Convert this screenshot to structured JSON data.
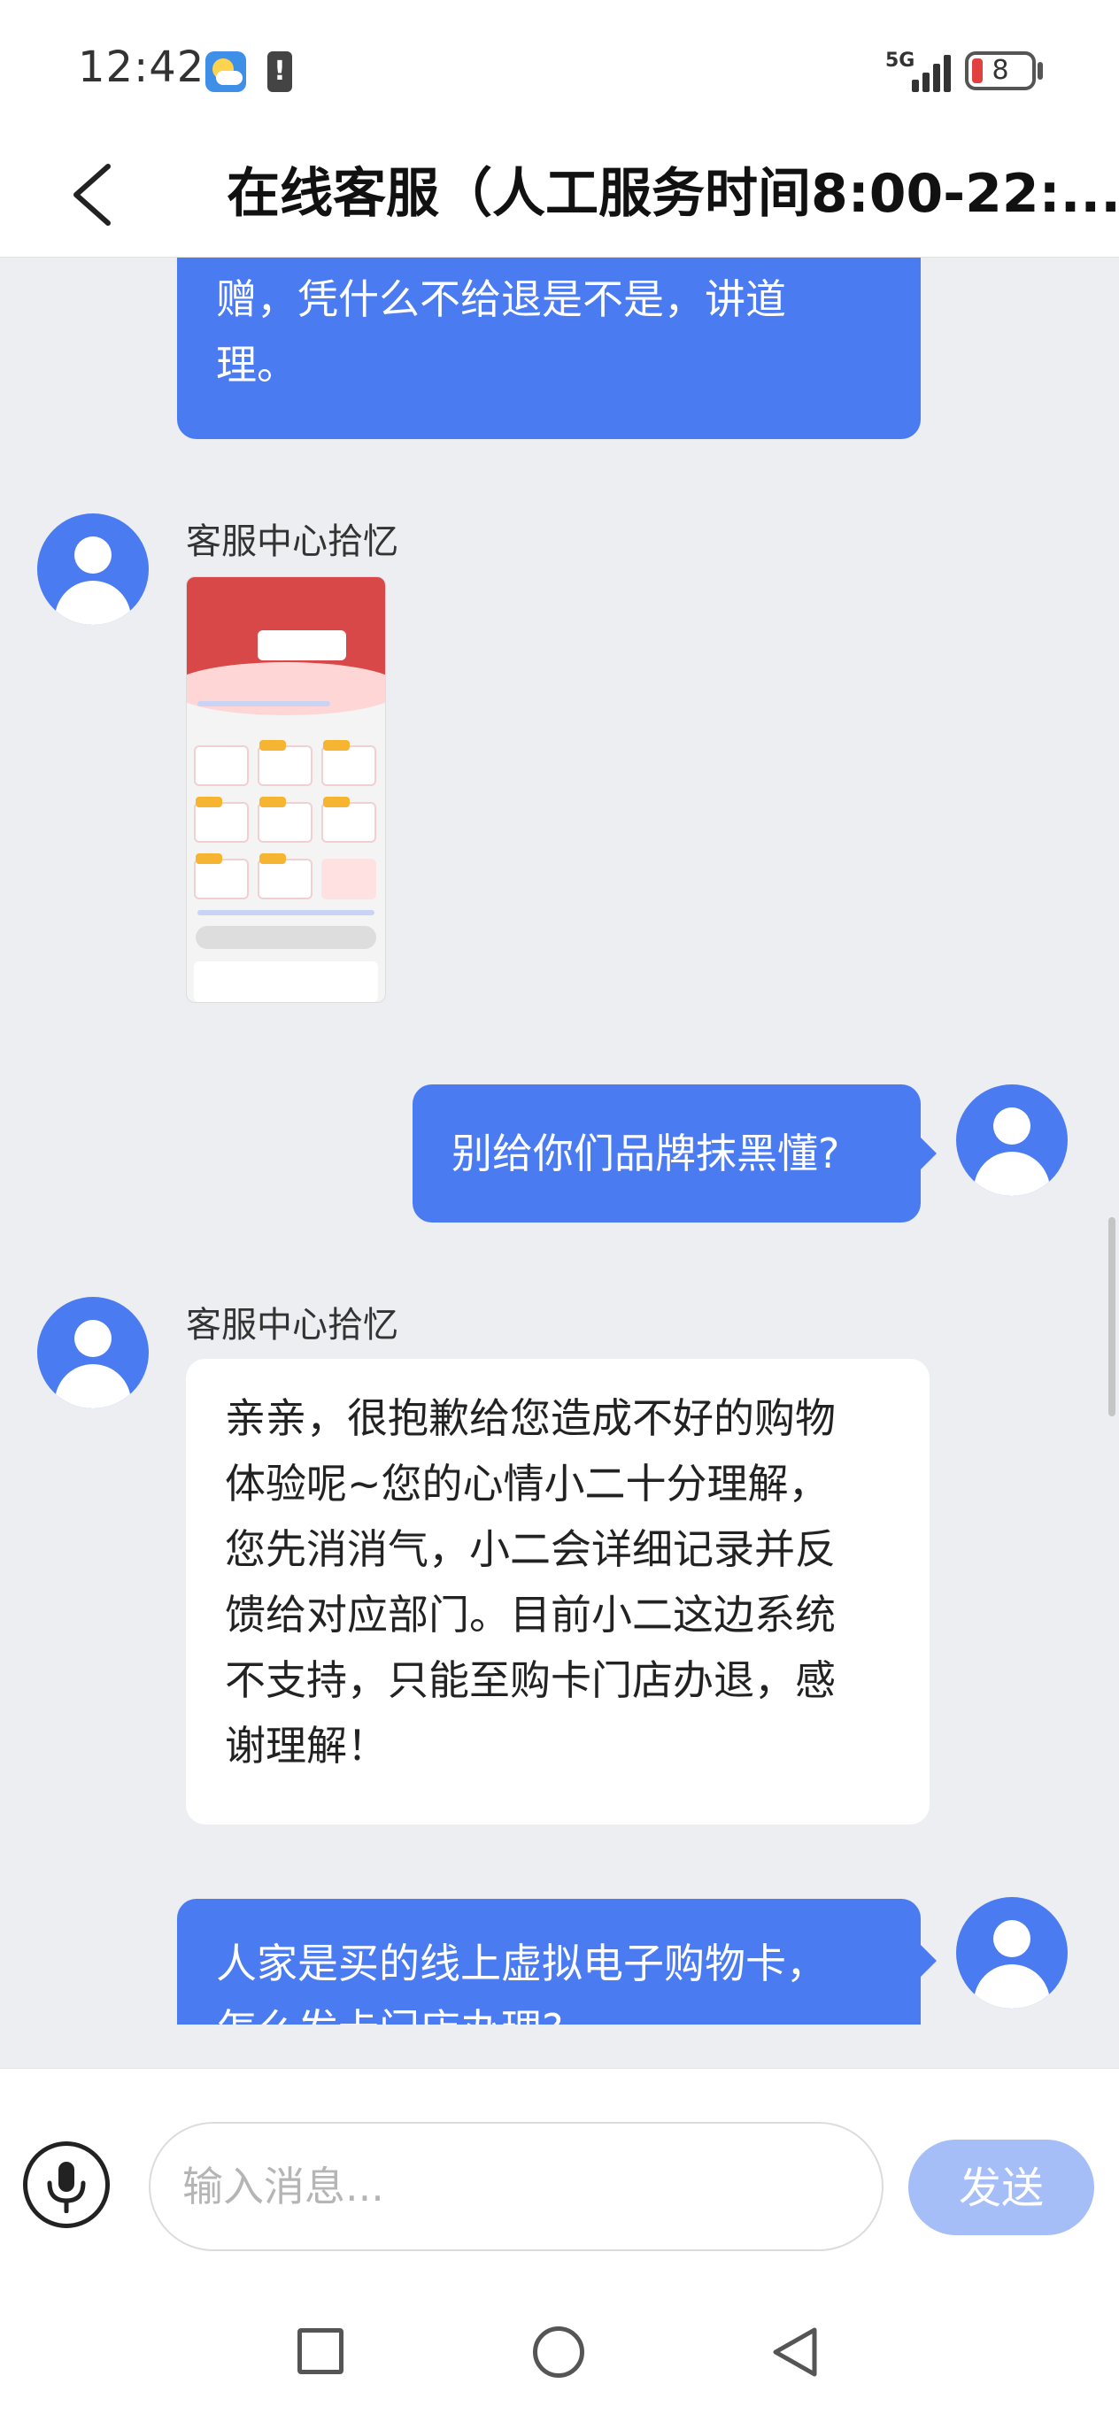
{
  "status_bar": {
    "time": "12:42",
    "network": "5G",
    "battery": "8",
    "alert_glyph": "!",
    "icons": [
      "weather-icon",
      "alert-icon",
      "signal-icon",
      "battery-icon"
    ]
  },
  "header": {
    "title": "在线客服（人工服务时间8:00-22:...",
    "back_icon": "chevron-left-icon"
  },
  "messages": [
    {
      "from": "user",
      "lines": [
        "赠，凭什么不给退是不是，讲道",
        "理。"
      ]
    },
    {
      "from": "agent",
      "name": "客服中心拾忆",
      "type": "image"
    },
    {
      "from": "user",
      "lines": [
        "别给你们品牌抹黑懂?"
      ]
    },
    {
      "from": "agent",
      "name": "客服中心拾忆",
      "lines": [
        "亲亲，很抱歉给您造成不好的购物",
        "体验呢~您的心情小二十分理解，",
        "您先消消气，小二会详细记录并反",
        "馈给对应部门。目前小二这边系统",
        "不支持，只能至购卡门店办退，感",
        "谢理解！"
      ]
    },
    {
      "from": "user",
      "lines": [
        "人家是买的线上虚拟电子购物卡，",
        "怎么发卡门店办理?"
      ]
    }
  ],
  "input": {
    "placeholder": "输入消息...",
    "send_label": "发送",
    "mic_icon": "microphone-icon"
  },
  "colors": {
    "accent": "#4b7bf1",
    "send_disabled": "#a5bef7",
    "chat_bg": "#edeef2"
  },
  "nav_bar": [
    "recents-square-icon",
    "home-circle-icon",
    "back-triangle-icon"
  ]
}
